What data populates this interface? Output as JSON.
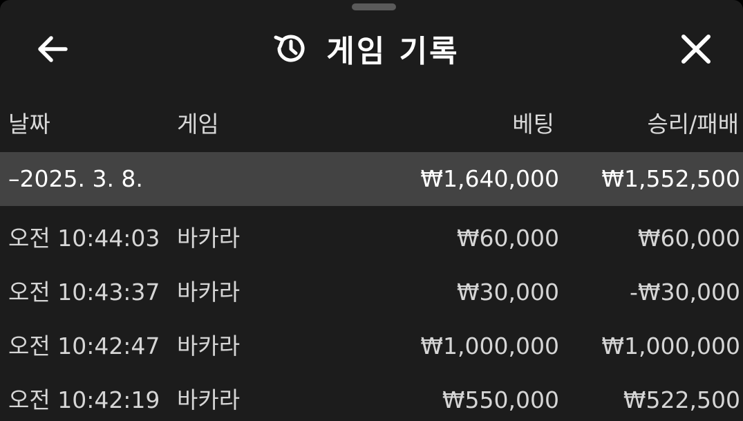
{
  "header": {
    "title": "게임 기록",
    "back_icon": "arrow-left-icon",
    "history_icon": "history-icon",
    "close_icon": "close-icon"
  },
  "columns": {
    "date": "날짜",
    "game": "게임",
    "bet": "베팅",
    "result": "승리/패배"
  },
  "summary": {
    "date": "–2025. 3. 8.",
    "bet": "₩1,640,000",
    "result": "₩1,552,500"
  },
  "records": [
    {
      "time": "오전 10:44:03",
      "game": "바카라",
      "bet": "₩60,000",
      "result": "₩60,000"
    },
    {
      "time": "오전 10:43:37",
      "game": "바카라",
      "bet": "₩30,000",
      "result": "-₩30,000"
    },
    {
      "time": "오전 10:42:47",
      "game": "바카라",
      "bet": "₩1,000,000",
      "result": "₩1,000,000"
    },
    {
      "time": "오전 10:42:19",
      "game": "바카라",
      "bet": "₩550,000",
      "result": "₩522,500"
    }
  ],
  "colors": {
    "background": "#1c1c1c",
    "summary_row": "#434343",
    "text_primary": "#ffffff",
    "text_secondary": "#d6d6d6"
  }
}
